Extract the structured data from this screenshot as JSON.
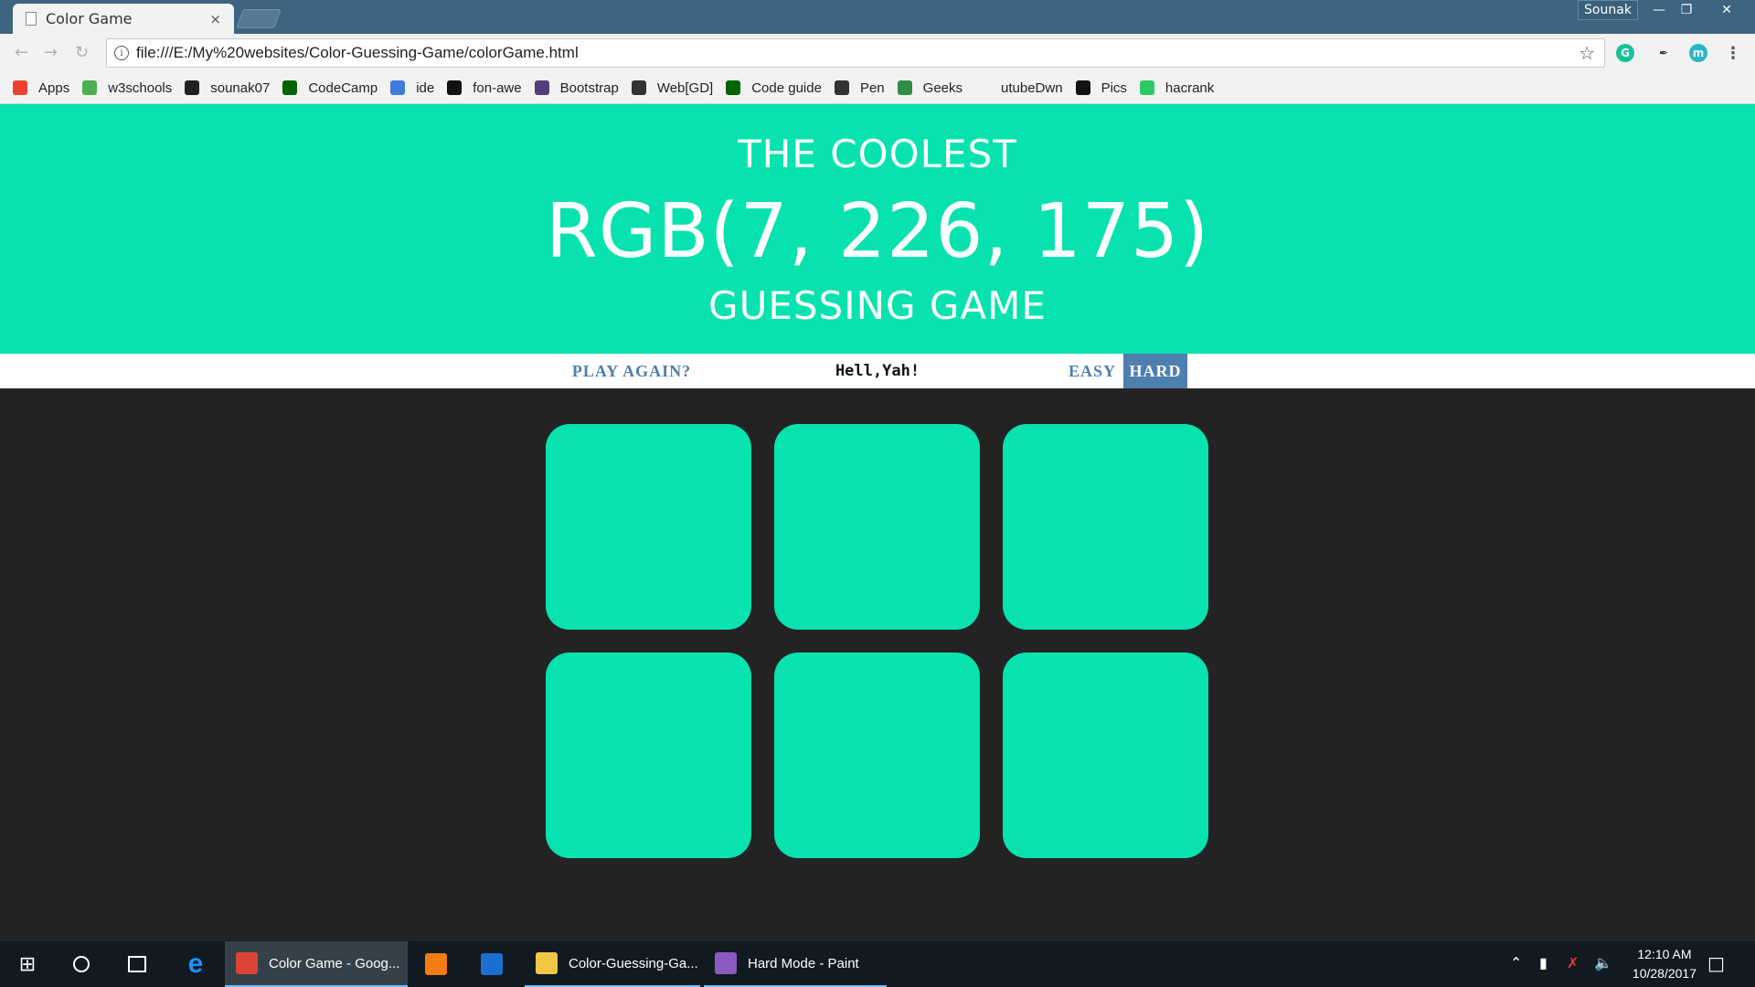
{
  "browser": {
    "tab_title": "Color Game",
    "tab_close": "×",
    "profile_name": "Sounak",
    "window_controls": {
      "minimize": "—",
      "restore": "❐",
      "close": "✕"
    },
    "url": "file:///E:/My%20websites/Color-Guessing-Game/colorGame.html",
    "bookmarks": [
      {
        "label": "Apps",
        "icon": "apps-grid-icon",
        "color": "#e94235"
      },
      {
        "label": "w3schools",
        "icon": "w3schools-icon",
        "color": "#4caf50"
      },
      {
        "label": "sounak07",
        "icon": "github-icon",
        "color": "#222222"
      },
      {
        "label": "CodeCamp",
        "icon": "freecodecamp-icon",
        "color": "#006400"
      },
      {
        "label": "ide",
        "icon": "eye-cloud-icon",
        "color": "#3b7dd8"
      },
      {
        "label": "fon-awe",
        "icon": "flag-icon",
        "color": "#111111"
      },
      {
        "label": "Bootstrap",
        "icon": "bootstrap-icon",
        "color": "#563d7c"
      },
      {
        "label": "Web[GD]",
        "icon": "webgd-icon",
        "color": "#333333"
      },
      {
        "label": "Code guide",
        "icon": "codeguide-icon",
        "color": "#006400"
      },
      {
        "label": "Pen",
        "icon": "codepen-icon",
        "color": "#333333"
      },
      {
        "label": "Geeks",
        "icon": "geeks-icon",
        "color": "#2f8d46"
      },
      {
        "label": "utubeDwn",
        "icon": "blank-icon",
        "color": "#f2f2f2"
      },
      {
        "label": "Pics",
        "icon": "camera-icon",
        "color": "#111111"
      },
      {
        "label": "hacrank",
        "icon": "hackerrank-icon",
        "color": "#2ec866"
      }
    ]
  },
  "game": {
    "header_line1": "THE COOLEST",
    "rgb_display": "RGB(7, 226, 175)",
    "header_line3": "GUESSING GAME",
    "header_color": "#07e2af",
    "play_again_label": "PLAY AGAIN?",
    "message": "Hell,Yah!",
    "easy_label": "EASY",
    "hard_label": "HARD",
    "selected_mode": "HARD",
    "accent_color": "#4f7fad",
    "squares": [
      "#07e2af",
      "#07e2af",
      "#07e2af",
      "#07e2af",
      "#07e2af",
      "#07e2af"
    ]
  },
  "taskbar": {
    "items": [
      {
        "label": "Color Game - Goog...",
        "icon": "chrome-icon",
        "state": "active"
      },
      {
        "label": "",
        "icon": "sublime-text-icon",
        "state": "pinned"
      },
      {
        "label": "",
        "icon": "store-app-icon",
        "state": "pinned"
      },
      {
        "label": "Color-Guessing-Ga...",
        "icon": "folder-icon",
        "state": "open"
      },
      {
        "label": "Hard Mode - Paint",
        "icon": "paint-icon",
        "state": "open"
      }
    ],
    "time": "12:10 AM",
    "date": "10/28/2017"
  }
}
